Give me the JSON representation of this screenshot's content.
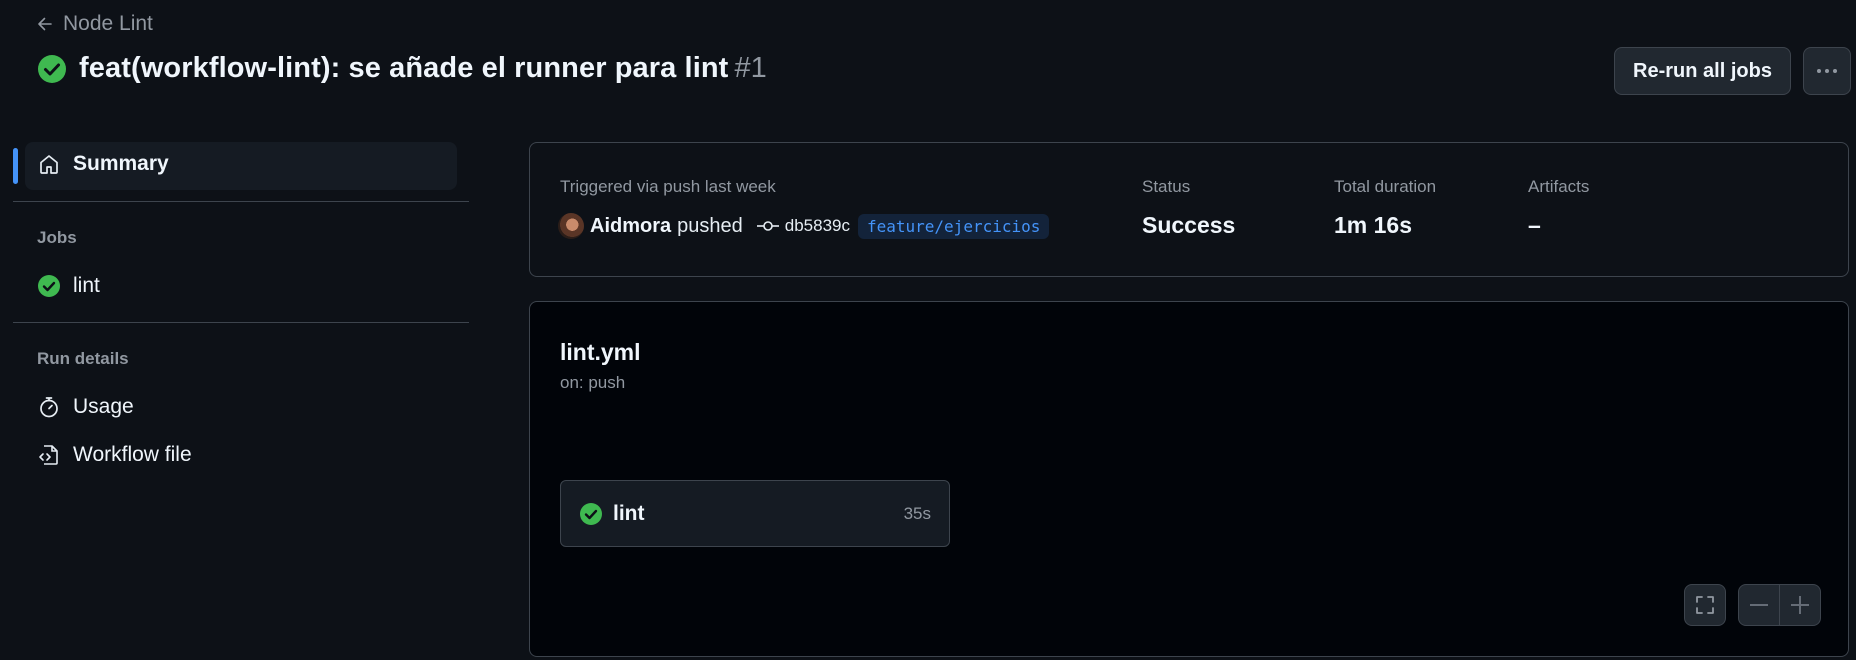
{
  "header": {
    "back_label": "Node Lint",
    "title": "feat(workflow-lint): se añade el runner para lint",
    "run_number": "#1",
    "rerun_label": "Re-run all jobs"
  },
  "sidebar": {
    "summary_label": "Summary",
    "jobs_heading": "Jobs",
    "jobs": [
      {
        "label": "lint"
      }
    ],
    "run_details_heading": "Run details",
    "run_details": [
      {
        "label": "Usage"
      },
      {
        "label": "Workflow file"
      }
    ]
  },
  "summary": {
    "trigger_label": "Triggered via push last week",
    "actor": "Aidmora",
    "action": "pushed",
    "commit": "db5839c",
    "branch": "feature/ejercicios",
    "status_label": "Status",
    "status_value": "Success",
    "duration_label": "Total duration",
    "duration_value": "1m 16s",
    "artifacts_label": "Artifacts",
    "artifacts_value": "–"
  },
  "graph": {
    "workflow_file": "lint.yml",
    "trigger": "on: push",
    "job": {
      "label": "lint",
      "duration": "35s"
    }
  },
  "colors": {
    "success": "#3fb950",
    "accent": "#4493f8",
    "background": "#0d1117"
  },
  "icons": [
    "arrow-left-icon",
    "check-circle-icon",
    "kebab-horizontal-icon",
    "home-icon",
    "stopwatch-icon",
    "file-code-icon",
    "git-commit-icon",
    "screen-full-icon",
    "dash-icon",
    "plus-icon"
  ]
}
